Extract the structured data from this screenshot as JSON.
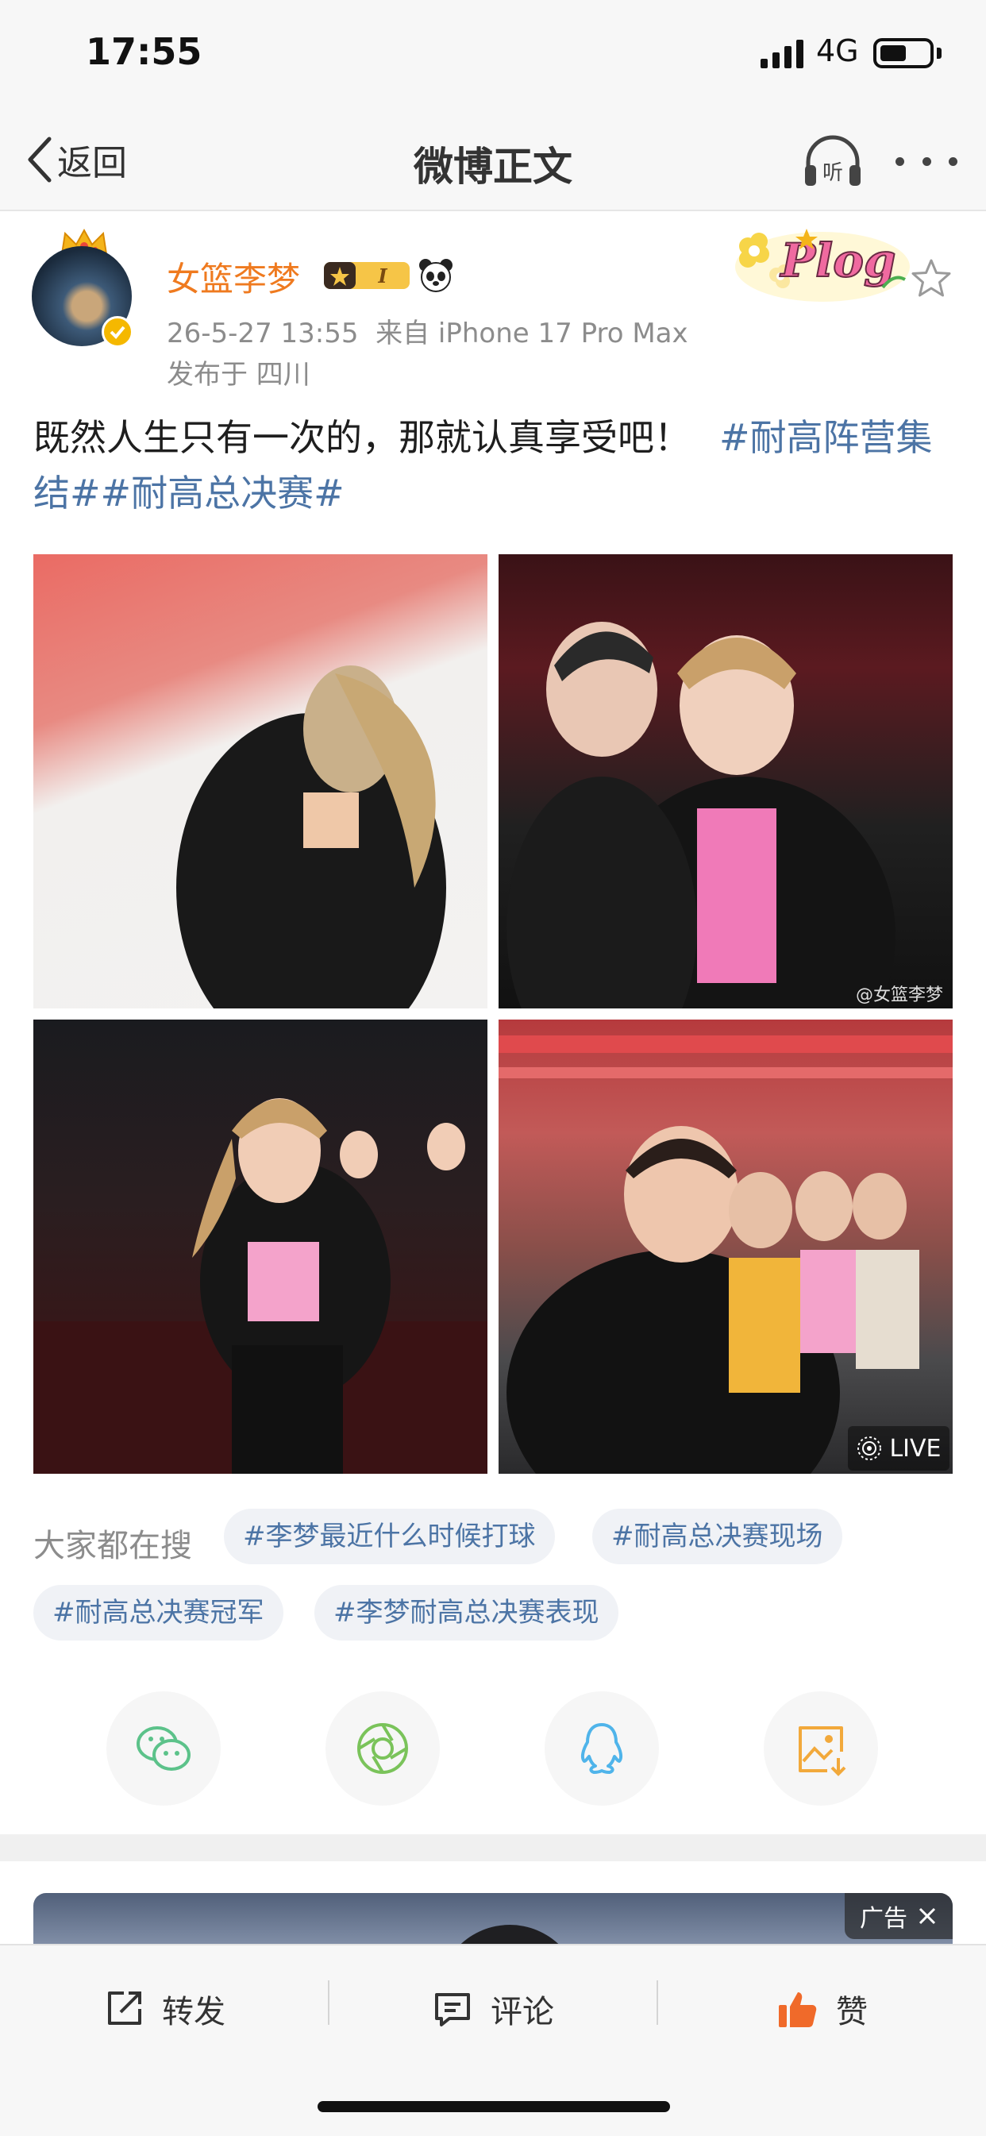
{
  "status_bar": {
    "time": "17:55",
    "network": "4G",
    "battery_level": 0.55
  },
  "nav": {
    "back_label": "返回",
    "title": "微博正文",
    "listen_label": "听"
  },
  "post": {
    "author": "女篮李梦",
    "vip_level": "I",
    "timestamp": "26-5-27 13:55",
    "source": "来自 iPhone 17 Pro Max",
    "location": "发布于 四川",
    "text": "既然人生只有一次的，那就认真享受吧！",
    "hashtags": "#耐高阵营集结##耐高总决赛#",
    "plog_label": "Plog",
    "photos": [
      {
        "label": "photo-1"
      },
      {
        "label": "photo-2",
        "watermark": "@女篮李梦"
      },
      {
        "label": "photo-3"
      },
      {
        "label": "photo-4",
        "badge": "LIVE"
      }
    ]
  },
  "search": {
    "label": "大家都在搜",
    "tags": [
      "#李梦最近什么时候打球",
      "#耐高总决赛现场",
      "#耐高总决赛冠军",
      "#李梦耐高总决赛表现"
    ]
  },
  "share": [
    {
      "icon": "wechat-icon",
      "color": "#5cc28a"
    },
    {
      "icon": "moments-icon",
      "color": "#7ac35a"
    },
    {
      "icon": "qq-icon",
      "color": "#4fb4ea"
    },
    {
      "icon": "save-image-icon",
      "color": "#f2a93b"
    }
  ],
  "ad": {
    "label": "广告"
  },
  "actions": {
    "repost": "转发",
    "comment": "评论",
    "like": "赞"
  },
  "colors": {
    "username": "#ef7a1f",
    "hashtag": "#4c74a5",
    "like": "#f06a2a"
  }
}
